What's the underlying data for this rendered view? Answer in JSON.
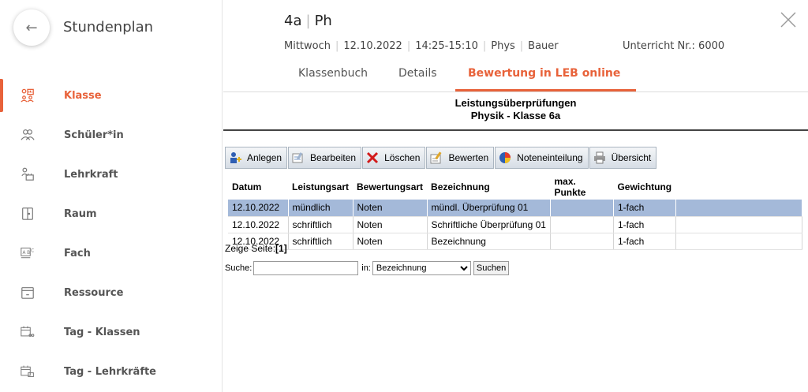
{
  "sidebar": {
    "title": "Stundenplan",
    "items": [
      {
        "label": "Klasse",
        "icon": "class-icon",
        "active": true
      },
      {
        "label": "Schüler*in",
        "icon": "students-icon",
        "active": false
      },
      {
        "label": "Lehrkraft",
        "icon": "teacher-icon",
        "active": false
      },
      {
        "label": "Raum",
        "icon": "room-door-icon",
        "active": false
      },
      {
        "label": "Fach",
        "icon": "subject-icon",
        "active": false
      },
      {
        "label": "Ressource",
        "icon": "resource-box-icon",
        "active": false
      },
      {
        "label": "Tag - Klassen",
        "icon": "calendar-group-icon",
        "active": false
      },
      {
        "label": "Tag - Lehrkräfte",
        "icon": "calendar-teacher-icon",
        "active": false
      }
    ]
  },
  "header": {
    "class": "4a",
    "subject": "Ph",
    "weekday": "Mittwoch",
    "date": "12.10.2022",
    "time": "14:25-15:10",
    "subject_long": "Phys",
    "teacher": "Bauer",
    "lesson_no": "Unterricht Nr.: 6000"
  },
  "tabs": [
    {
      "label": "Klassenbuch",
      "active": false
    },
    {
      "label": "Details",
      "active": false
    },
    {
      "label": "Bewertung in LEB online",
      "active": true
    }
  ],
  "frame": {
    "title": "Leistungsüberprüfungen",
    "subtitle": "Physik - Klasse 6a",
    "toolbar": [
      {
        "label": "Anlegen",
        "icon": "add-user-icon"
      },
      {
        "label": "Bearbeiten",
        "icon": "edit-icon"
      },
      {
        "label": "Löschen",
        "icon": "delete-x-icon"
      },
      {
        "label": "Bewerten",
        "icon": "grade-pen-icon"
      },
      {
        "label": "Noteneinteilung",
        "icon": "grade-scale-icon"
      },
      {
        "label": "Übersicht",
        "icon": "printer-icon"
      }
    ],
    "columns": [
      "Datum",
      "Leistungsart",
      "Bewertungsart",
      "Bezeichnung",
      "max. Punkte",
      "Gewichtung"
    ],
    "rows": [
      {
        "datum": "12.10.2022",
        "leistungsart": "mündlich",
        "bewertungsart": "Noten",
        "bezeichnung": "mündl. Überprüfung 01",
        "max_punkte": "",
        "gewichtung": "1-fach",
        "selected": true
      },
      {
        "datum": "12.10.2022",
        "leistungsart": "schriftlich",
        "bewertungsart": "Noten",
        "bezeichnung": "Schriftliche Überprüfung 01",
        "max_punkte": "",
        "gewichtung": "1-fach",
        "selected": false
      },
      {
        "datum": "12.10.2022",
        "leistungsart": "schriftlich",
        "bewertungsart": "Noten",
        "bezeichnung": "Bezeichnung",
        "max_punkte": "",
        "gewichtung": "1-fach",
        "selected": false
      }
    ],
    "pager_label": "Zeige Seite:",
    "pager_current": "[1]",
    "search_label": "Suche:",
    "search_value": "",
    "in_label": "in:",
    "search_field": "Bezeichnung",
    "search_button": "Suchen"
  },
  "colors": {
    "accent": "#e8623a",
    "selected_row": "#a4b9d9"
  }
}
